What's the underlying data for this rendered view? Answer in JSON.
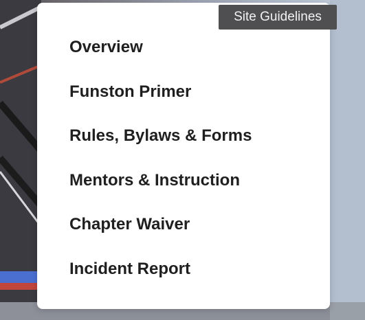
{
  "tooltip": {
    "text": "Site Guidelines"
  },
  "menu": {
    "items": [
      {
        "label": "Overview"
      },
      {
        "label": "Funston Primer"
      },
      {
        "label": "Rules, Bylaws & Forms"
      },
      {
        "label": "Mentors & Instruction"
      },
      {
        "label": "Chapter Waiver"
      },
      {
        "label": "Incident Report"
      }
    ]
  },
  "colors": {
    "panel_background": "#ffffff",
    "menu_text": "#1f1f1f",
    "tooltip_background": "#4f4f51",
    "tooltip_text": "#f2f2f2"
  }
}
